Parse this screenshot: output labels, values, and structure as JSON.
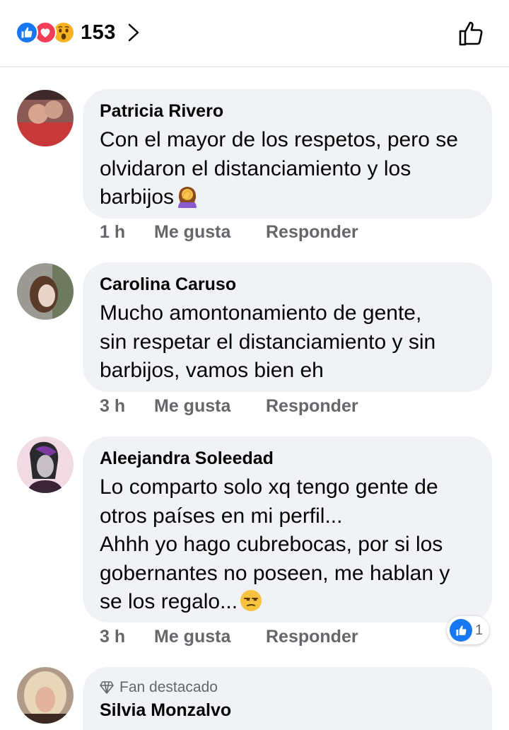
{
  "header": {
    "reaction_icons": [
      "like-icon",
      "love-icon",
      "wow-icon"
    ],
    "reaction_count": "153",
    "colors": {
      "like": "#1877f2",
      "love": "#f33e58",
      "wow": "#f7b125"
    }
  },
  "comments": [
    {
      "author": "Patricia Rivero",
      "lines": [
        "Con el mayor de los respetos, pero se",
        "olvidaron el distanciamiento y los",
        "barbijos"
      ],
      "trailing_emoji": "woman-facepalming",
      "time": "1 h",
      "like_label": "Me gusta",
      "reply_label": "Responder"
    },
    {
      "author": "Carolina Caruso",
      "lines": [
        "Mucho amontonamiento de gente,",
        "sin respetar el distanciamiento y sin",
        "barbijos, vamos bien eh"
      ],
      "time": "3 h",
      "like_label": "Me gusta",
      "reply_label": "Responder"
    },
    {
      "author": "Aleejandra Soleedad",
      "lines": [
        "Lo comparto solo xq tengo gente de",
        "otros países en mi perfil...",
        "Ahhh yo hago cubrebocas, por si los",
        "gobernantes no poseen, me hablan y",
        "se los regalo..."
      ],
      "trailing_emoji": "unamused-face",
      "time": "3 h",
      "like_label": "Me gusta",
      "reply_label": "Responder",
      "reactions": {
        "icon": "like-icon",
        "count": "1"
      }
    },
    {
      "badge": "Fan destacado",
      "author": "Silvia Monzalvo"
    }
  ]
}
